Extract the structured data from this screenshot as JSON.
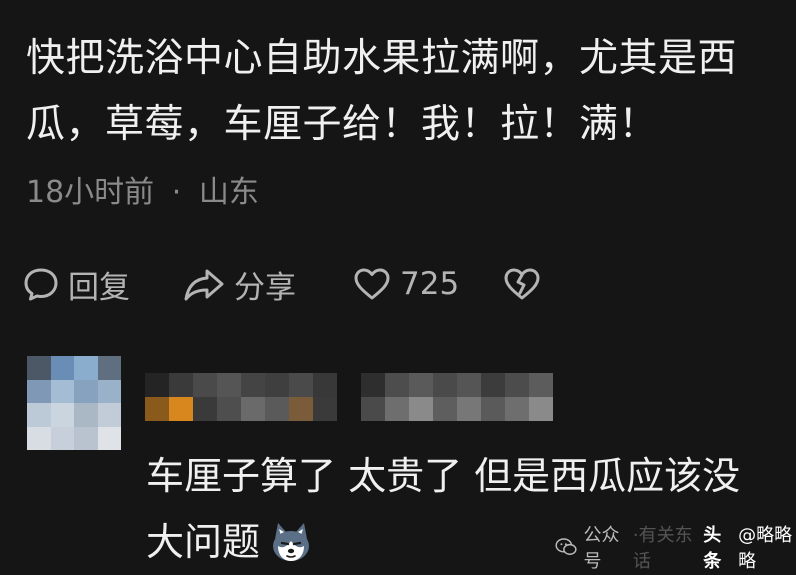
{
  "comment": {
    "text": "快把洗浴中心自助水果拉满啊，尤其是西瓜，草莓，车厘子给！我！拉！满！",
    "time": "18小时前",
    "separator": "·",
    "location": "山东"
  },
  "actions": {
    "reply_label": "回复",
    "share_label": "分享",
    "like_count": "725"
  },
  "reply": {
    "text": "车厘子算了 太贵了 但是西瓜应该没大问题"
  },
  "watermark": {
    "wechat_label": "公众号",
    "faded_text": "·有关东话",
    "brand": "头条",
    "handle": "@略略略"
  },
  "colors": {
    "background": "#151515",
    "text": "#f0f0f0",
    "meta": "#8a8a8a",
    "action": "#b4b4b4"
  },
  "icons": [
    "comment-bubble-icon",
    "share-arrow-icon",
    "heart-icon",
    "broken-heart-icon",
    "husky-emoji-icon",
    "wechat-icon"
  ]
}
